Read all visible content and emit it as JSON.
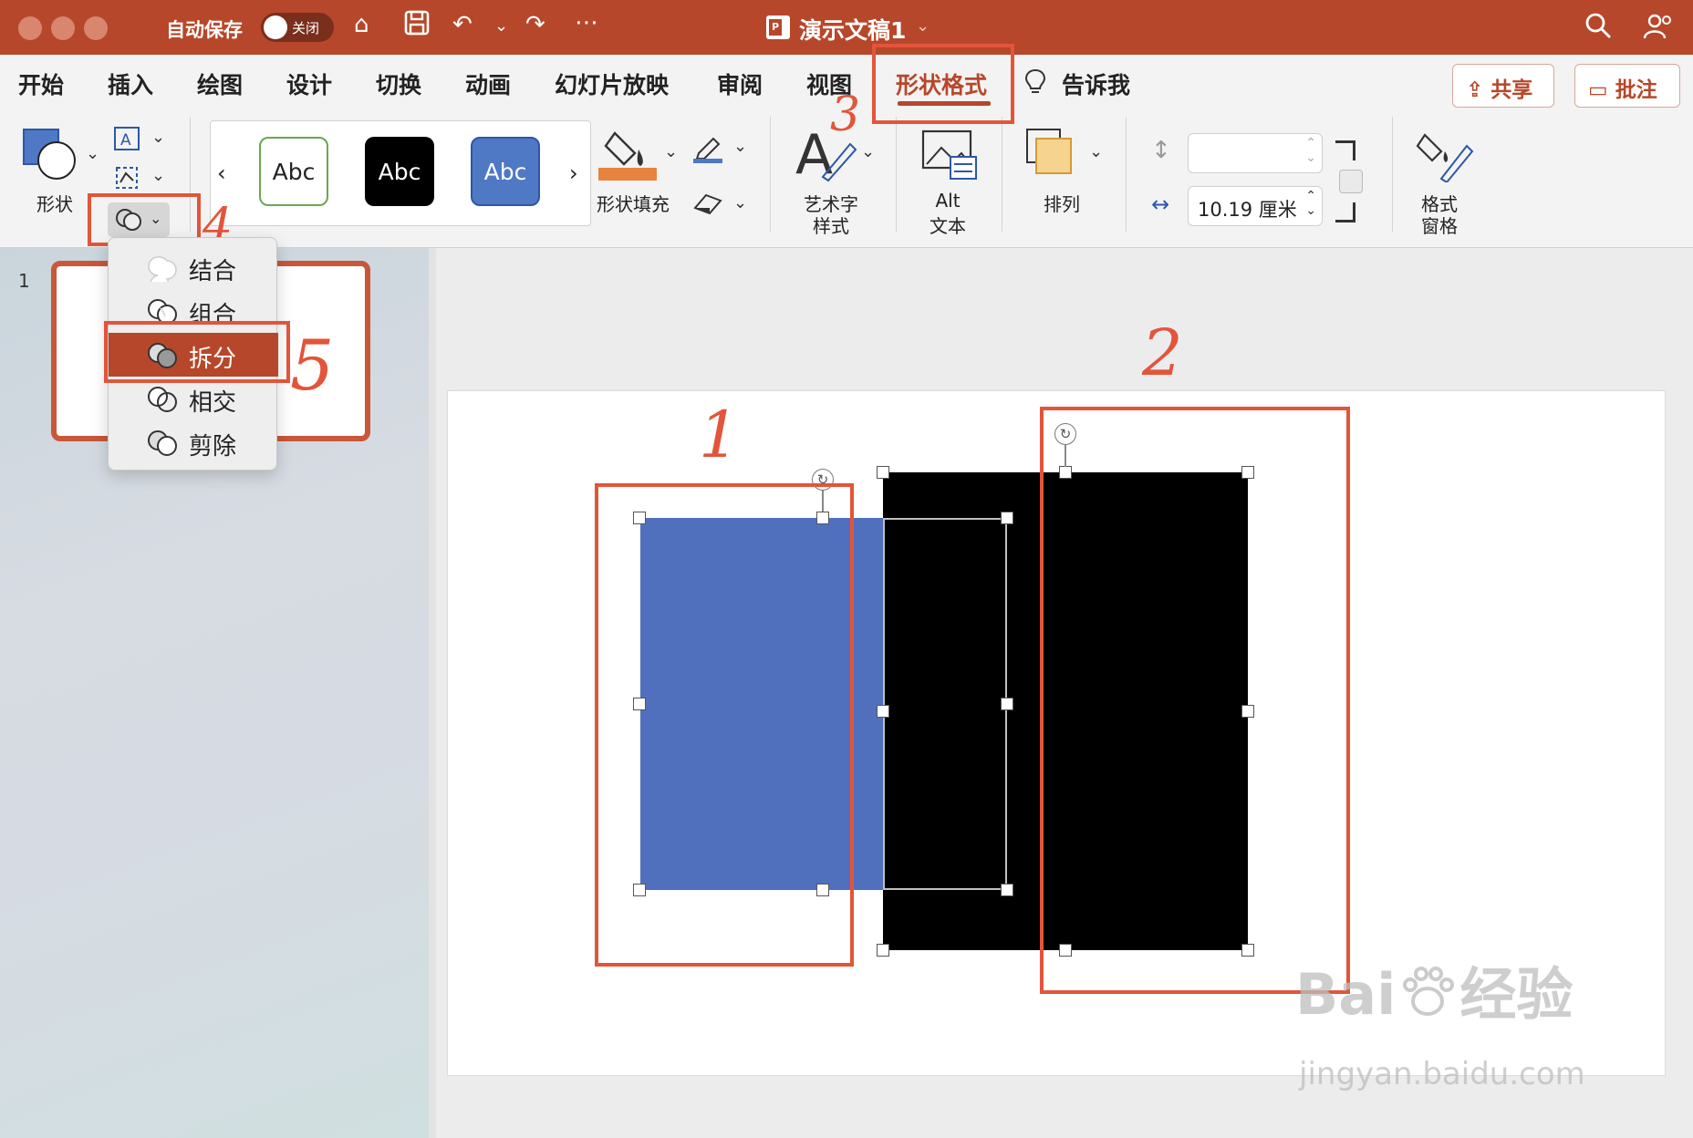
{
  "titlebar": {
    "autosave_label": "自动保存",
    "toggle_state": "关闭",
    "doc_title": "演示文稿1"
  },
  "tabs": [
    "开始",
    "插入",
    "绘图",
    "设计",
    "切换",
    "动画",
    "幻灯片放映",
    "审阅",
    "视图",
    "形状格式",
    "告诉我"
  ],
  "active_tab": "形状格式",
  "header_buttons": {
    "share": "共享",
    "comment": "批注"
  },
  "ribbon": {
    "shape_label": "形状",
    "style_samples": [
      "Abc",
      "Abc",
      "Abc"
    ],
    "fill_label": "形状填充",
    "wordart_label_1": "艺术字",
    "wordart_label_2": "样式",
    "alt_label_1": "Alt",
    "alt_label_2": "文本",
    "arrange_label": "排列",
    "height_value": "",
    "width_value": "10.19 厘米",
    "format_pane_label_1": "格式",
    "format_pane_label_2": "窗格"
  },
  "merge_menu": {
    "items": [
      "结合",
      "组合",
      "拆分",
      "相交",
      "剪除"
    ],
    "selected": "拆分"
  },
  "slide_panel": {
    "slide_number": "1"
  },
  "annotations": [
    "1",
    "2",
    "3",
    "4",
    "5"
  ],
  "watermark": {
    "brand": "Bai",
    "product": "经验",
    "url": "jingyan.baidu.com"
  },
  "colors": {
    "accent": "#b7472a",
    "shape_blue": "#5070bd",
    "shape_black": "#000000",
    "annotation_red": "#e2553a"
  }
}
